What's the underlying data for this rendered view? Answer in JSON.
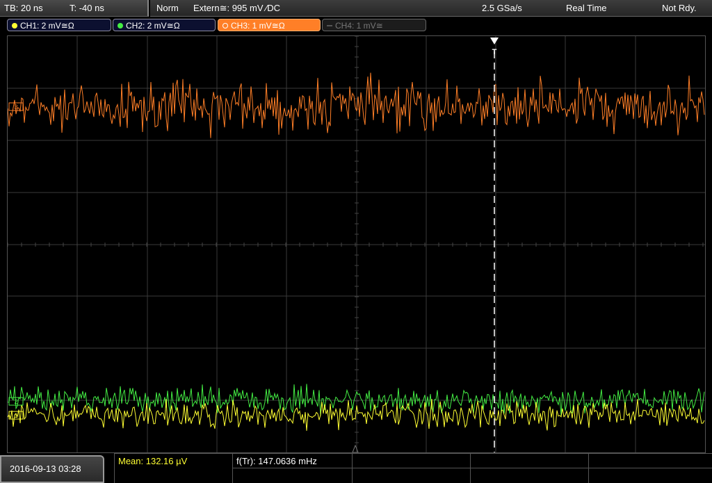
{
  "topbar": {
    "timebase": "TB: 20 ns",
    "trigger_time": "T: -40 ns",
    "mode": "Norm",
    "trigger_source": "Extern≅: 995 mV ∕DC",
    "sample_rate": "2.5 GSa/s",
    "acq_mode": "Real Time",
    "status": "Not Rdy."
  },
  "channels": [
    {
      "label": "CH1: 2 mV≅Ω",
      "color": "#ffff33",
      "active": true
    },
    {
      "label": "CH2: 2 mV≅Ω",
      "color": "#44ee44",
      "active": true
    },
    {
      "label": "CH3: 1 mV≅Ω",
      "color": "#ff7f27",
      "active": true,
      "selected": true
    },
    {
      "label": "CH4: 1 mV≅",
      "color": "#777777",
      "active": false
    }
  ],
  "markers": {
    "trigger": "T",
    "ch3_ref": "3",
    "ch2_ref": "2",
    "ch1_ref": "1"
  },
  "measurements": {
    "mean": "Mean: 132.16 µV",
    "freq": "f(Tr): 147.0636 mHz"
  },
  "datetime": "2016-09-13 03:28",
  "colors": {
    "ch1": "#ffff33",
    "ch2": "#44ee44",
    "ch3": "#ff7f27",
    "grid": "#3a3a3a",
    "trigger_line": "#ffffff"
  }
}
